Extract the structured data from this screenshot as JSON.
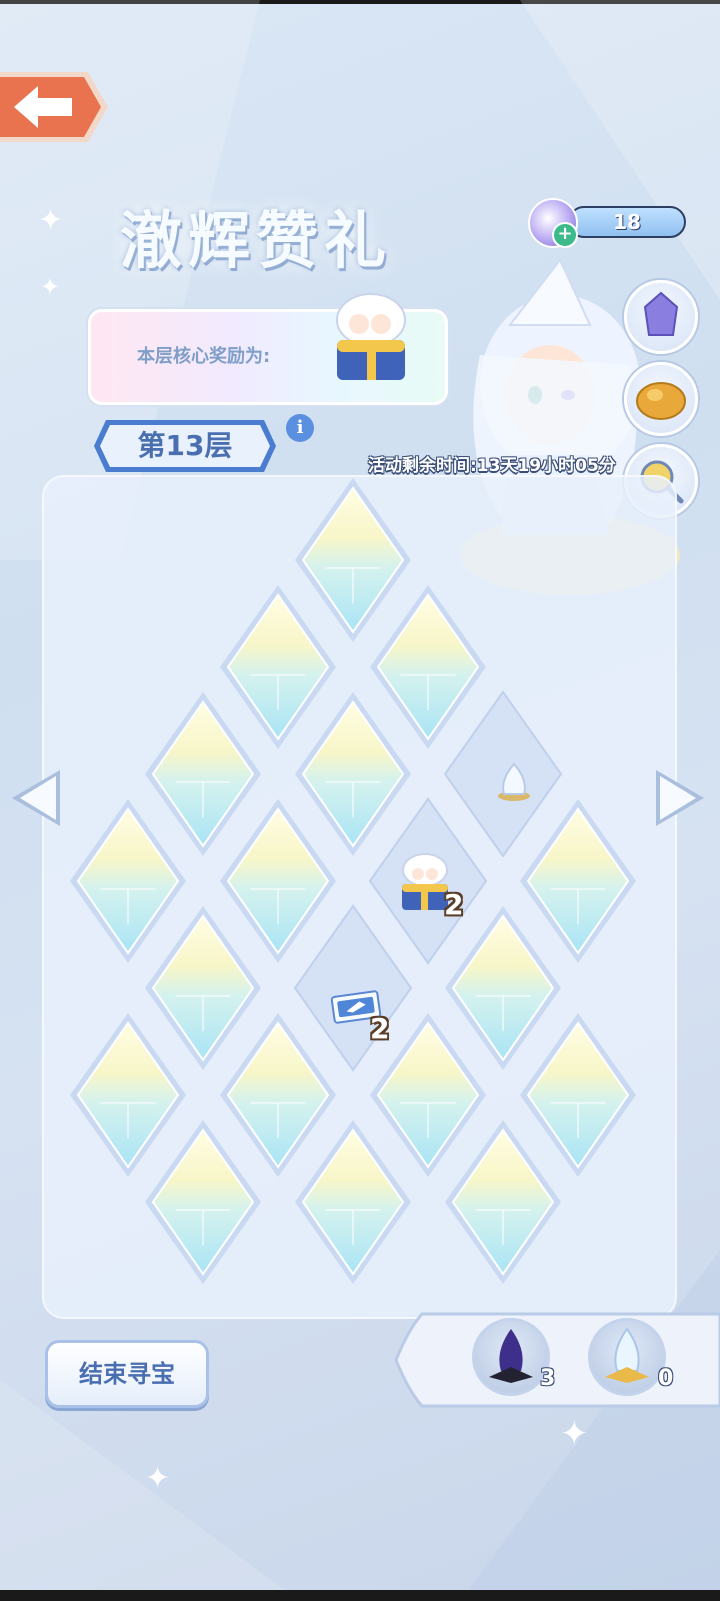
{
  "header": {
    "title": "澈辉赞礼",
    "currency_value": "18"
  },
  "reward": {
    "label": "本层核心奖励为:"
  },
  "floor": {
    "label": "第13层",
    "info_icon": "i"
  },
  "event": {
    "countdown": "活动剩余时间:13天19小时05分"
  },
  "board": {
    "cells": [
      {
        "state": "hidden"
      },
      {
        "state": "hidden"
      },
      {
        "state": "hidden"
      },
      {
        "state": "hidden"
      },
      {
        "state": "hidden"
      },
      {
        "state": "revealed",
        "item": "crystal-egg"
      },
      {
        "state": "hidden"
      },
      {
        "state": "hidden"
      },
      {
        "state": "revealed",
        "item": "cookie-box",
        "count": "2"
      },
      {
        "state": "hidden"
      },
      {
        "state": "hidden"
      },
      {
        "state": "revealed",
        "item": "ticket",
        "count": "2"
      },
      {
        "state": "hidden"
      },
      {
        "state": "hidden"
      },
      {
        "state": "hidden"
      },
      {
        "state": "hidden"
      },
      {
        "state": "hidden"
      },
      {
        "state": "hidden"
      },
      {
        "state": "hidden"
      },
      {
        "state": "hidden"
      }
    ],
    "cookie_box_count": "2",
    "ticket_count": "2"
  },
  "footer": {
    "end_button": "结束寻宝"
  },
  "inventory": {
    "dark_crystal_count": "3",
    "light_crystal_count": "0"
  },
  "colors": {
    "accent": "#4a6fb1",
    "back_button": "#e8734e"
  }
}
